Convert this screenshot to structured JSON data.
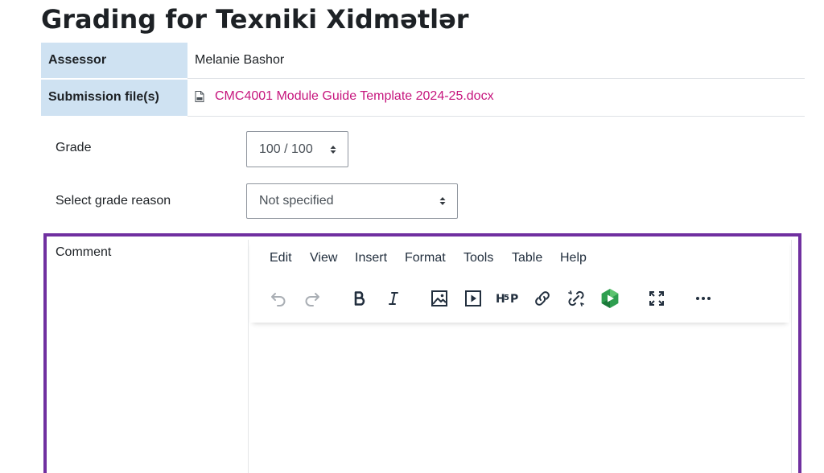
{
  "page": {
    "title": "Grading for Texniki Xidmətlər"
  },
  "info_table": {
    "assessor_label": "Assessor",
    "assessor_value": "Melanie Bashor",
    "submission_label": "Submission file(s)",
    "submission_file": "CMC4001 Module Guide Template 2024-25.docx"
  },
  "form": {
    "grade_label": "Grade",
    "grade_value": "100 / 100",
    "reason_label": "Select grade reason",
    "reason_value": "Not specified",
    "comment_label": "Comment"
  },
  "editor": {
    "menu": [
      "Edit",
      "View",
      "Insert",
      "Format",
      "Tools",
      "Table",
      "Help"
    ],
    "toolbar_icons": [
      "undo-icon",
      "redo-icon",
      "bold-icon",
      "italic-icon",
      "image-icon",
      "media-icon",
      "h5p-icon",
      "link-icon",
      "unlink-icon",
      "panopto-icon",
      "fullscreen-icon",
      "more-icon"
    ]
  },
  "colors": {
    "link": "#c6157d",
    "table_header_bg": "#cfe2f2",
    "highlight_border": "#7030a0"
  }
}
